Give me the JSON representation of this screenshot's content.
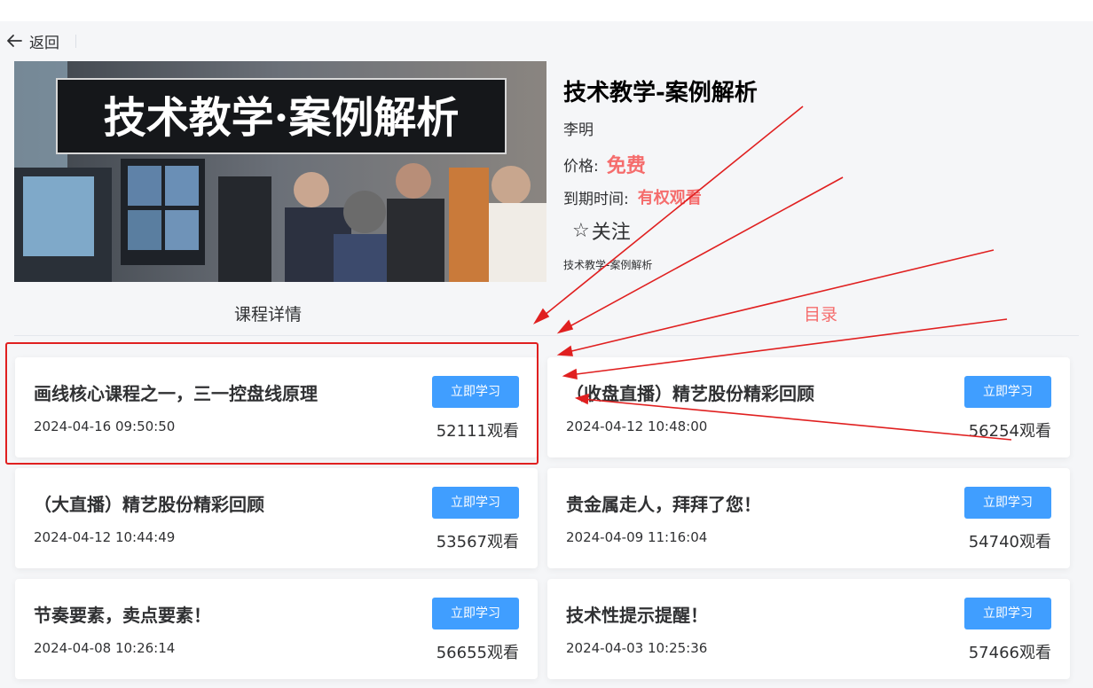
{
  "back": {
    "label": "返回"
  },
  "course": {
    "cover_text": "技术教学·案例解析",
    "title": "技术教学-案例解析",
    "teacher": "李明",
    "price_label": "价格:",
    "price_value": "免费",
    "expire_label": "到期时间:",
    "expire_value": "有权观看",
    "follow_icon": "☆",
    "follow_label": "关注",
    "description": "技术教学-案例解析"
  },
  "tabs": [
    {
      "label": "课程详情",
      "active": false
    },
    {
      "label": "目录",
      "active": true
    }
  ],
  "lessons": [
    {
      "title": "画线核心课程之一，三一控盘线原理",
      "date": "2024-04-16 09:50:50",
      "button": "立即学习",
      "views": "52111观看"
    },
    {
      "title": "（收盘直播）精艺股份精彩回顾",
      "date": "2024-04-12 10:48:00",
      "button": "立即学习",
      "views": "56254观看"
    },
    {
      "title": "（大直播）精艺股份精彩回顾",
      "date": "2024-04-12 10:44:49",
      "button": "立即学习",
      "views": "53567观看"
    },
    {
      "title": "贵金属走人，拜拜了您！",
      "date": "2024-04-09 11:16:04",
      "button": "立即学习",
      "views": "54740观看"
    },
    {
      "title": "节奏要素，卖点要素！",
      "date": "2024-04-08 10:26:14",
      "button": "立即学习",
      "views": "56655观看"
    },
    {
      "title": "技术性提示提醒！",
      "date": "2024-04-03 10:25:36",
      "button": "立即学习",
      "views": "57466观看"
    }
  ],
  "colors": {
    "accent_red": "#f56c6c",
    "button_blue": "#409eff",
    "annotation_red": "#e02020"
  }
}
